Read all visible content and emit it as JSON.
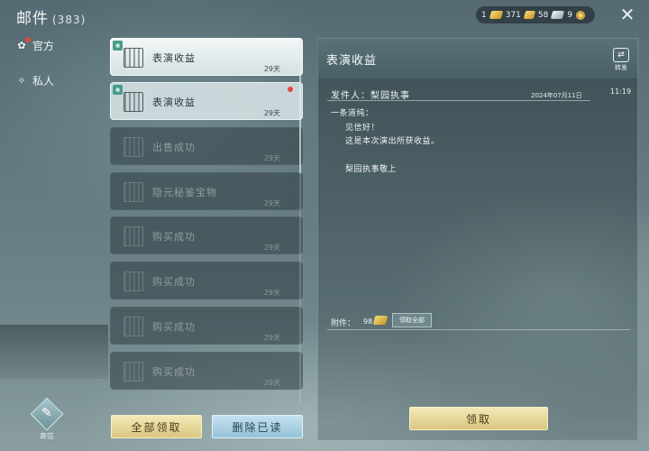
{
  "header": {
    "title": "邮件",
    "count": "(383)",
    "currency": {
      "gold": "1",
      "ingot": "371",
      "silver": "58",
      "coin": "9"
    },
    "close_icon": "close-icon"
  },
  "sidebar": {
    "items": [
      {
        "label": "官方",
        "icon": "flower-icon",
        "unread": true
      },
      {
        "label": "私人",
        "icon": "diamond-icon",
        "unread": false
      }
    ],
    "write_label": "寄信"
  },
  "mail_list": [
    {
      "subject": "表演收益",
      "days": "29天",
      "state": "selected",
      "badge": true,
      "dot": false
    },
    {
      "subject": "表演收益",
      "days": "29天",
      "state": "unread",
      "badge": true,
      "dot": true
    },
    {
      "subject": "出售成功",
      "days": "29天",
      "state": "read",
      "badge": false,
      "dot": false
    },
    {
      "subject": "隐元秘鉴宝物",
      "days": "29天",
      "state": "read",
      "badge": false,
      "dot": false
    },
    {
      "subject": "购买成功",
      "days": "29天",
      "state": "read",
      "badge": false,
      "dot": false
    },
    {
      "subject": "购买成功",
      "days": "29天",
      "state": "read",
      "badge": false,
      "dot": false
    },
    {
      "subject": "购买成功",
      "days": "29天",
      "state": "read",
      "badge": false,
      "dot": false
    },
    {
      "subject": "购买成功",
      "days": "29天",
      "state": "read",
      "badge": false,
      "dot": false
    }
  ],
  "list_actions": {
    "claim_all": "全部领取",
    "delete_read": "删除已读"
  },
  "detail": {
    "title": "表演收益",
    "translate_label": "转发",
    "sender": "发件人：梨园执事",
    "date": "2024年07月11日",
    "time": "11:19",
    "body": {
      "greeting": "一条道纯：",
      "line1": "见信好！",
      "line2": "这是本次演出所获收益。",
      "signature": "梨园执事敬上"
    },
    "attachment_label": "附件：",
    "attachment_qty": "98",
    "claim_all_small": "领取全部",
    "claim_button": "领取"
  },
  "colors": {
    "gold_button": "#e8dca0",
    "blue_button": "#a9d2e6",
    "red_dot": "#e04a3a"
  }
}
